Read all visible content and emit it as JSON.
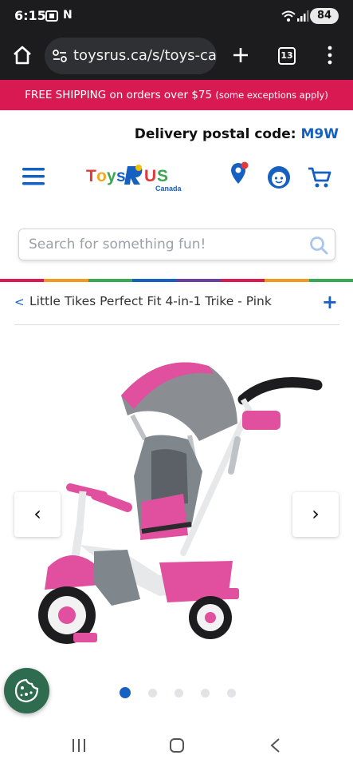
{
  "status_bar": {
    "time": "6:15",
    "notification_icons": [
      "screenshot-icon",
      "n-app-icon"
    ],
    "battery": "84"
  },
  "browser": {
    "url": "toysrus.ca/s/toys-ca...",
    "tab_count": "13"
  },
  "promo": {
    "text": "FREE SHIPPING on orders over $75",
    "note": "(some exceptions apply)"
  },
  "delivery": {
    "label": "Delivery postal code:",
    "code": "M9W"
  },
  "logo": {
    "wordmark": "Toys R Us",
    "sub": "Canada"
  },
  "search": {
    "placeholder": "Search for something fun!"
  },
  "breadcrumb": {
    "back": "<",
    "title": "Little Tikes Perfect Fit 4-in-1 Trike - Pink",
    "expand": "+"
  },
  "gallery": {
    "prev": "‹",
    "next": "›",
    "slide_count": 5,
    "active_index": 0
  },
  "colors": {
    "brand_blue": "#1560c0",
    "promo_red": "#d91a52",
    "trike_pink": "#e0509e",
    "cookie_green": "#2e6b4f"
  }
}
